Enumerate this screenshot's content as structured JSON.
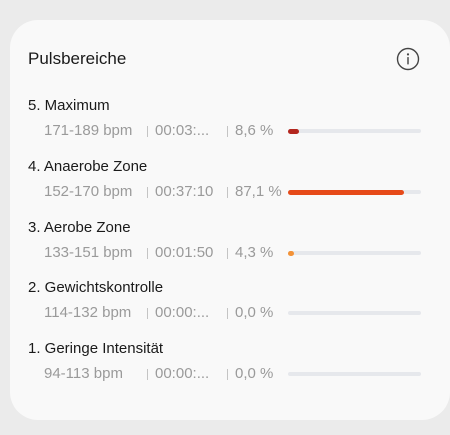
{
  "card": {
    "title": "Pulsbereiche",
    "info_icon": "info-circle-icon"
  },
  "zones": [
    {
      "name": "5. Maximum",
      "bpm": "171-189 bpm",
      "time": "00:03:...",
      "percent": "8,6 %",
      "fill_fraction": 0.086,
      "color": "#b3261e"
    },
    {
      "name": "4. Anaerobe Zone",
      "bpm": "152-170 bpm",
      "time": "00:37:10",
      "percent": "87,1 %",
      "fill_fraction": 0.871,
      "color": "#e64a19"
    },
    {
      "name": "3. Aerobe Zone",
      "bpm": "133-151 bpm",
      "time": "00:01:50",
      "percent": "4,3 %",
      "fill_fraction": 0.043,
      "color": "#f39237"
    },
    {
      "name": "2. Gewichtskontrolle",
      "bpm": "114-132 bpm",
      "time": "00:00:...",
      "percent": "0,0 %",
      "fill_fraction": 0.0,
      "color": "#f6c343"
    },
    {
      "name": "1. Geringe Intensität",
      "bpm": "94-113 bpm",
      "time": "00:00:...",
      "percent": "0,0 %",
      "fill_fraction": 0.0,
      "color": "#9ccc65"
    }
  ]
}
